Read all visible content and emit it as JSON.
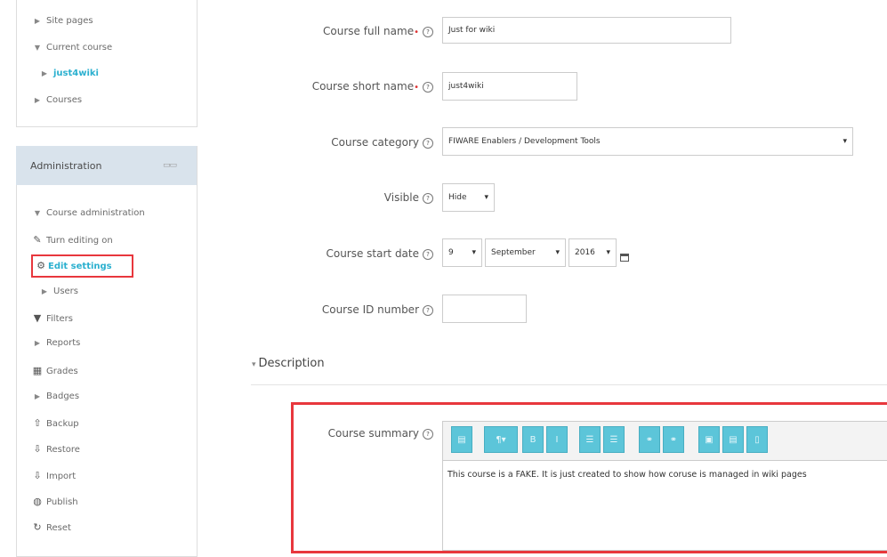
{
  "navigation": {
    "items": [
      {
        "icon": "caret-right-icon",
        "label": "Site pages"
      },
      {
        "icon": "caret-down-icon",
        "label": "Current course"
      },
      {
        "icon": "caret-right-icon",
        "label": "just4wiki"
      },
      {
        "icon": "caret-right-icon",
        "label": "Courses"
      }
    ]
  },
  "administration": {
    "title": "Administration",
    "items": [
      {
        "icon": "caret-down-icon",
        "label": "Course administration"
      },
      {
        "icon": "pencil-icon",
        "label": "Turn editing on"
      },
      {
        "icon": "gear-icon",
        "label": "Edit settings"
      },
      {
        "icon": "caret-right-icon",
        "label": "Users"
      },
      {
        "icon": "filter-icon",
        "label": "Filters"
      },
      {
        "icon": "caret-right-icon",
        "label": "Reports"
      },
      {
        "icon": "table-icon",
        "label": "Grades"
      },
      {
        "icon": "caret-right-icon",
        "label": "Badges"
      },
      {
        "icon": "upload-icon",
        "label": "Backup"
      },
      {
        "icon": "download-icon",
        "label": "Restore"
      },
      {
        "icon": "import-icon",
        "label": "Import"
      },
      {
        "icon": "globe-icon",
        "label": "Publish"
      },
      {
        "icon": "reset-icon",
        "label": "Reset"
      }
    ]
  },
  "form": {
    "full_name": {
      "label": "Course full name",
      "value": "Just for wiki"
    },
    "short_name": {
      "label": "Course short name",
      "value": "just4wiki"
    },
    "category": {
      "label": "Course category",
      "value": "FIWARE Enablers / Development Tools"
    },
    "visible": {
      "label": "Visible",
      "value": "Hide"
    },
    "start_date": {
      "label": "Course start date",
      "day": "9",
      "month": "September",
      "year": "2016"
    },
    "id_number": {
      "label": "Course ID number",
      "value": ""
    },
    "description_section": "Description",
    "summary": {
      "label": "Course summary",
      "text": "This course is a FAKE. It is just created to show how coruse is managed in wiki pages"
    }
  },
  "colors": {
    "accent": "#2bb0cf",
    "highlight": "#e8373d",
    "toolbar": "#5cc5d9",
    "admin_header": "#d9e3ec"
  }
}
